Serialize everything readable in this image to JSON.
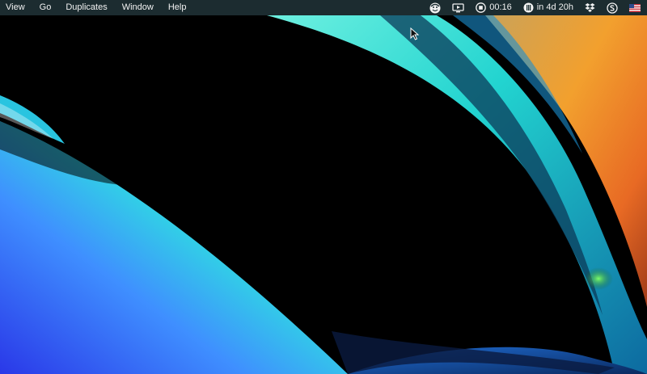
{
  "menubar": {
    "menus": [
      {
        "label": "View"
      },
      {
        "label": "Go"
      },
      {
        "label": "Duplicates"
      },
      {
        "label": "Window"
      },
      {
        "label": "Help"
      }
    ],
    "status": {
      "recording_time": "00:16",
      "countdown": "in 4d 20h",
      "icons": [
        "face-avatar-icon",
        "screen-share-icon",
        "stop-record-icon",
        "clock-globe-icon",
        "dropbox-icon",
        "skype-icon",
        "us-flag-icon"
      ]
    }
  },
  "colors": {
    "menubar_bg": "#1e3034",
    "menubar_text": "#f2f2f2",
    "wallpaper_teal": "#2ee6d6",
    "wallpaper_blue": "#1f5bd8",
    "wallpaper_orange": "#f29a2e"
  }
}
